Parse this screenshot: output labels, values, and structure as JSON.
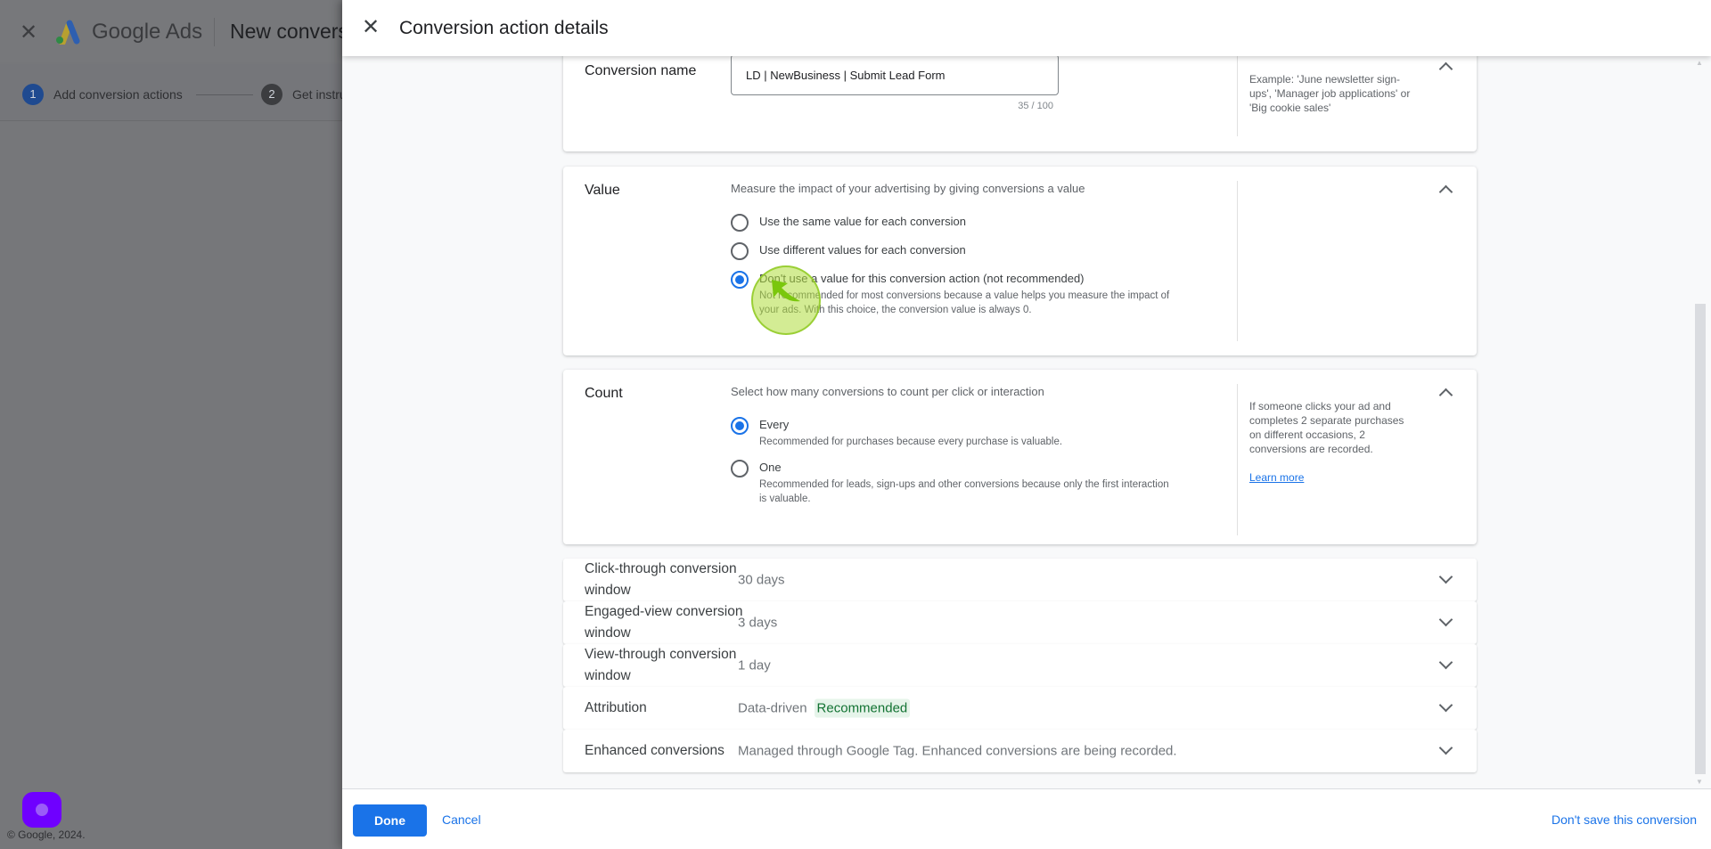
{
  "background": {
    "brand": "Google Ads",
    "title": "New conversion action",
    "steps": [
      {
        "num": "1",
        "label": "Add conversion actions"
      },
      {
        "num": "2",
        "label": "Get instructions"
      }
    ],
    "footer": "© Google, 2024."
  },
  "panel": {
    "title": "Conversion action details",
    "conversion_name": {
      "label": "Conversion name",
      "value": "LD | NewBusiness | Submit Lead Form",
      "count": "35 / 100",
      "help": "Example: 'June newsletter sign-ups', 'Manager job applications' or 'Big cookie sales'"
    },
    "value": {
      "label": "Value",
      "description": "Measure the impact of your advertising by giving conversions a value",
      "options": [
        {
          "label": "Use the same value for each conversion",
          "checked": false
        },
        {
          "label": "Use different values for each conversion",
          "checked": false
        },
        {
          "label": "Don't use a value for this conversion action (not recommended)",
          "sub": "Not recommended for most conversions because a value helps you measure the impact of your ads. With this choice, the conversion value is always 0.",
          "checked": true
        }
      ]
    },
    "count": {
      "label": "Count",
      "description": "Select how many conversions to count per click or interaction",
      "options": [
        {
          "label": "Every",
          "sub": "Recommended for purchases because every purchase is valuable.",
          "checked": true
        },
        {
          "label": "One",
          "sub": "Recommended for leads, sign-ups and other conversions because only the first interaction is valuable.",
          "checked": false
        }
      ],
      "help": "If someone clicks your ad and completes 2 separate purchases on different occasions, 2 conversions are recorded.",
      "learn_more": "Learn more"
    },
    "rows": [
      {
        "label": "Click-through conversion window",
        "value": "30 days"
      },
      {
        "label": "Engaged-view conversion window",
        "value": "3 days"
      },
      {
        "label": "View-through conversion window",
        "value": "1 day"
      },
      {
        "label": "Attribution",
        "value": "Data-driven",
        "badge": "Recommended"
      },
      {
        "label": "Enhanced conversions",
        "value": "Managed through Google Tag. Enhanced conversions are being recorded."
      }
    ],
    "footer": {
      "done": "Done",
      "cancel": "Cancel",
      "dont_save": "Don't save this conversion"
    }
  },
  "colors": {
    "accent": "#1a73e8",
    "recommended_bg": "#e6f4ea",
    "recommended_text": "#137333",
    "widget": "#6f00ff"
  }
}
